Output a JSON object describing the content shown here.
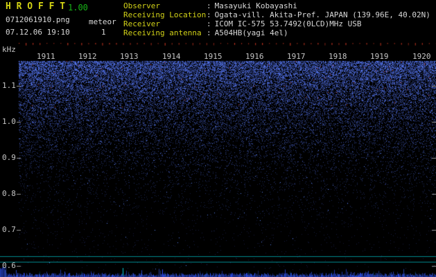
{
  "app": {
    "title_display": "H R O F F T",
    "version": "1.00",
    "filename": "0712061910.png",
    "mode": "meteor",
    "datetime": "07.12.06 19:10",
    "meteor_count": "1"
  },
  "info": {
    "rows": [
      {
        "label": "Observer",
        "sep": ":",
        "value": "Masayuki Kobayashi"
      },
      {
        "label": "Receiving Location",
        "sep": ":",
        "value": "Ogata-vill. Akita-Pref. JAPAN (139.96E, 40.02N)"
      },
      {
        "label": "Receiver",
        "sep": ":",
        "value": "ICOM IC-575 53.7492(0LCD)MHz USB"
      },
      {
        "label": "Receiving antenna",
        "sep": ":",
        "value": "A504HB(yagi 4el)"
      }
    ]
  },
  "chart_data": {
    "type": "heatmap",
    "title": "HROFFT 10-minute meteor-radio spectrogram",
    "x_axis": "time of day (HHMM), 1-minute tick intervals over 10 minutes",
    "x_tick_labels": [
      "1911",
      "1912",
      "1913",
      "1914",
      "1915",
      "1916",
      "1917",
      "1918",
      "1919",
      "1920"
    ],
    "y_axis_label": "kHz",
    "y_tick_labels": [
      "1.1",
      "1.0",
      "0.9",
      "0.8",
      "0.7",
      "0.6"
    ],
    "y_range_khz": [
      0.6,
      1.15
    ],
    "legend_position": "none",
    "grid": false,
    "content_description": "Broadband blue background noise speckle, densest above ~1.0 kHz and fading to black toward lower frequencies; no strong meteor-echo streaks during this interval; sparse red 10-second tick marks along the top edge of the plot; two horizontal cyan signal-level reference lines near the bottom and a jagged blue noise-level trace along the bottom edge with a cyan minute marker.",
    "palette": {
      "noise_blue": "#2848d8",
      "bright_speck": "#7aa0ff",
      "red_tick": "#c23420",
      "cyan_line": "#00979c",
      "trace_blue": "#2d4be0",
      "axis_text": "#c6c6c6",
      "label_yellow": "#d2d218",
      "version_green": "#17b417",
      "header_text": "#d8d8d8",
      "background": "#000000"
    }
  }
}
